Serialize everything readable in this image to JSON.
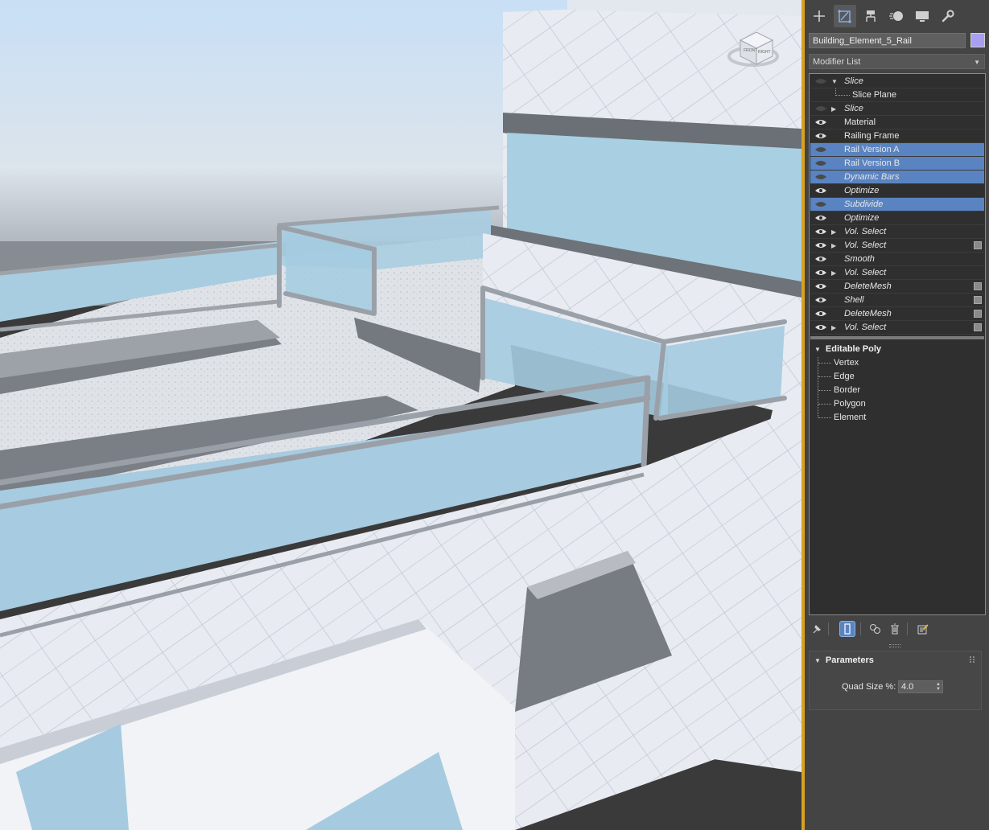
{
  "object": {
    "name": "Building_Element_5_Rail",
    "color": "#a89ff0"
  },
  "command_tabs": [
    {
      "id": "create",
      "icon": "plus-icon"
    },
    {
      "id": "modify",
      "icon": "modify-icon",
      "active": true
    },
    {
      "id": "hierarchy",
      "icon": "hierarchy-icon"
    },
    {
      "id": "motion",
      "icon": "motion-icon"
    },
    {
      "id": "display",
      "icon": "display-icon"
    },
    {
      "id": "utilities",
      "icon": "wrench-icon"
    }
  ],
  "modifier_list": {
    "label": "Modifier List"
  },
  "viewcube": {
    "face_front": "FRONT",
    "face_right": "RIGHT"
  },
  "stack": {
    "items": [
      {
        "label": "Slice",
        "italic": true,
        "eye": "off",
        "expand": "down"
      },
      {
        "label": "Slice Plane",
        "sub": true
      },
      {
        "label": "Slice",
        "italic": true,
        "eye": "off",
        "expand": "right"
      },
      {
        "label": "Material",
        "eye": "on"
      },
      {
        "label": "Railing Frame",
        "eye": "on"
      },
      {
        "label": "Rail Version A",
        "eye": "off",
        "selected": true
      },
      {
        "label": "Rail Version B",
        "eye": "off",
        "selected": true
      },
      {
        "label": "Dynamic Bars",
        "italic": true,
        "eye": "off",
        "selected": true
      },
      {
        "label": "Optimize",
        "italic": true,
        "eye": "on"
      },
      {
        "label": "Subdivide",
        "italic": true,
        "eye": "off",
        "selected": true
      },
      {
        "label": "Optimize",
        "italic": true,
        "eye": "on"
      },
      {
        "label": "Vol. Select",
        "italic": true,
        "eye": "on",
        "expand": "right"
      },
      {
        "label": "Vol. Select",
        "italic": true,
        "eye": "on",
        "expand": "right",
        "box": true
      },
      {
        "label": "Smooth",
        "italic": true,
        "eye": "on"
      },
      {
        "label": "Vol. Select",
        "italic": true,
        "eye": "on",
        "expand": "right"
      },
      {
        "label": "DeleteMesh",
        "italic": true,
        "eye": "on",
        "box": true
      },
      {
        "label": "Shell",
        "italic": true,
        "eye": "on",
        "box": true
      },
      {
        "label": "DeleteMesh",
        "italic": true,
        "eye": "on",
        "box": true
      },
      {
        "label": "Vol. Select",
        "italic": true,
        "eye": "on",
        "expand": "right",
        "box": true
      }
    ],
    "base": {
      "label": "Editable Poly",
      "sub_objects": [
        "Vertex",
        "Edge",
        "Border",
        "Polygon",
        "Element"
      ]
    }
  },
  "stack_tools": [
    {
      "icon": "pin-stack-icon"
    },
    {
      "icon": "show-end-result-icon",
      "active": true
    },
    {
      "icon": "make-unique-icon"
    },
    {
      "icon": "remove-modifier-icon"
    },
    {
      "icon": "configure-modifier-sets-icon"
    }
  ],
  "parameters": {
    "title": "Parameters",
    "quad_size_label": "Quad Size %:",
    "quad_size_value": "4.0"
  }
}
